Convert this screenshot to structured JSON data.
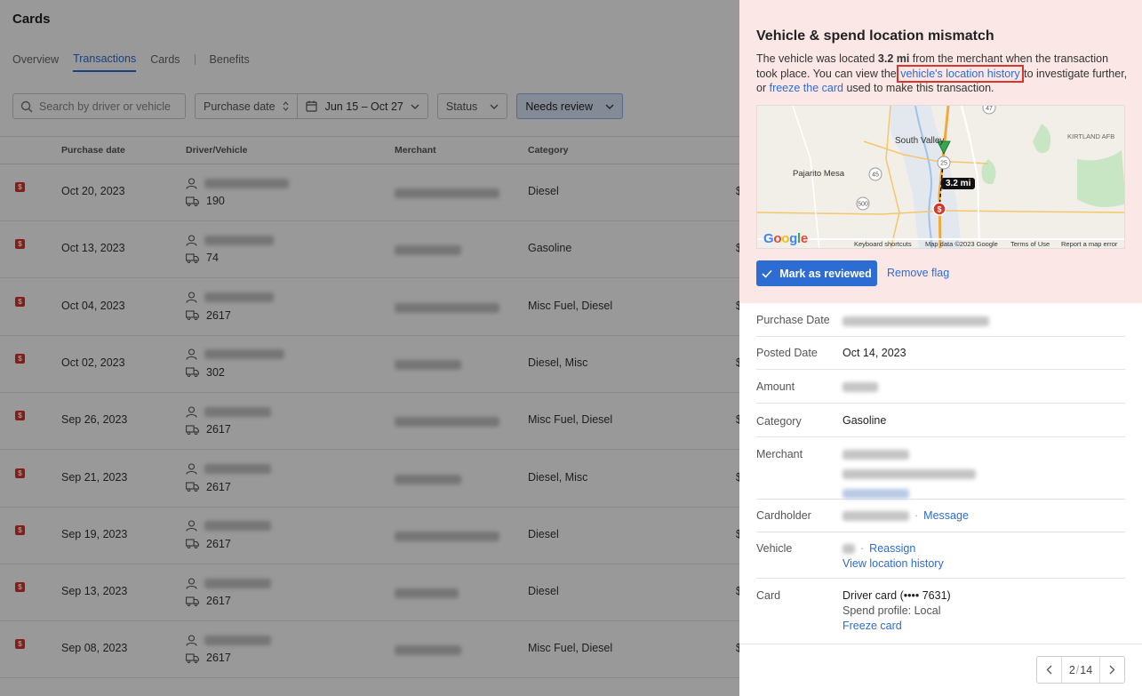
{
  "page": {
    "title": "Cards",
    "tabs": [
      "Overview",
      "Transactions",
      "Cards",
      "Benefits"
    ],
    "active_tab": "Transactions"
  },
  "filters": {
    "search_placeholder": "Search by driver or vehicle",
    "purchase_date_label": "Purchase date",
    "date_range": "Jun 15 – Oct 27",
    "status_label": "Status",
    "needs_review_label": "Needs review"
  },
  "table": {
    "columns": [
      "Purchase date",
      "Driver/Vehicle",
      "Merchant",
      "Category"
    ],
    "rows": [
      {
        "date": "Oct 20, 2023",
        "vehicle": "190",
        "category": "Diesel",
        "amount_cut": "$"
      },
      {
        "date": "Oct 13, 2023",
        "vehicle": "74",
        "category": "Gasoline",
        "amount_cut": "$"
      },
      {
        "date": "Oct 04, 2023",
        "vehicle": "2617",
        "category": "Misc Fuel, Diesel",
        "amount_cut": "$"
      },
      {
        "date": "Oct 02, 2023",
        "vehicle": "302",
        "category": "Diesel, Misc",
        "amount_cut": "$"
      },
      {
        "date": "Sep 26, 2023",
        "vehicle": "2617",
        "category": "Misc Fuel, Diesel",
        "amount_cut": "$"
      },
      {
        "date": "Sep 21, 2023",
        "vehicle": "2617",
        "category": "Diesel, Misc",
        "amount_cut": "$"
      },
      {
        "date": "Sep 19, 2023",
        "vehicle": "2617",
        "category": "Diesel",
        "amount_cut": "$"
      },
      {
        "date": "Sep 13, 2023",
        "vehicle": "2617",
        "category": "Diesel",
        "amount_cut": "$"
      },
      {
        "date": "Sep 08, 2023",
        "vehicle": "2617",
        "category": "Misc Fuel, Diesel",
        "amount_cut": "$"
      }
    ],
    "flag_glyph": "$"
  },
  "panel": {
    "alert": {
      "title": "Vehicle & spend location mismatch",
      "text_1": "The vehicle was located ",
      "distance_bold": "3.2 mi",
      "text_2": " from the merchant when the transaction took place. You can view the ",
      "location_link": "vehicle's location history",
      "text_3": " to investigate further, or ",
      "freeze_link": "freeze the card",
      "text_4": " used to make this transaction."
    },
    "map": {
      "distance_badge": "3.2 mi",
      "places": [
        "South Valley",
        "Pajarito Mesa",
        "KIRTLAND AFB"
      ],
      "route_shields": [
        "47",
        "500",
        "45",
        "25"
      ],
      "provider": "Google",
      "attribution": [
        "Keyboard shortcuts",
        "Map data ©2023 Google",
        "Terms of Use",
        "Report a map error"
      ],
      "marker_glyph": "$"
    },
    "actions": {
      "mark_reviewed": "Mark as reviewed",
      "remove_flag": "Remove flag"
    },
    "details": {
      "purchase_date_label": "Purchase Date",
      "posted_date_label": "Posted Date",
      "posted_date": "Oct 14, 2023",
      "amount_label": "Amount",
      "category_label": "Category",
      "category": "Gasoline",
      "merchant_label": "Merchant",
      "cardholder_label": "Cardholder",
      "message_link": "Message",
      "vehicle_label": "Vehicle",
      "reassign_link": "Reassign",
      "view_history_link": "View location history",
      "card_label": "Card",
      "card_name": "Driver card (•••• 7631)",
      "spend_profile": "Spend profile: Local",
      "freeze_card_link": "Freeze card",
      "separator": "·"
    },
    "pager": {
      "current": "2",
      "separator": "/",
      "total": "14"
    }
  },
  "colors": {
    "accent": "#2d6cd2",
    "alert_bg": "#fce7e7",
    "flag": "#d9352b",
    "review_chip": "#dce8fb"
  }
}
